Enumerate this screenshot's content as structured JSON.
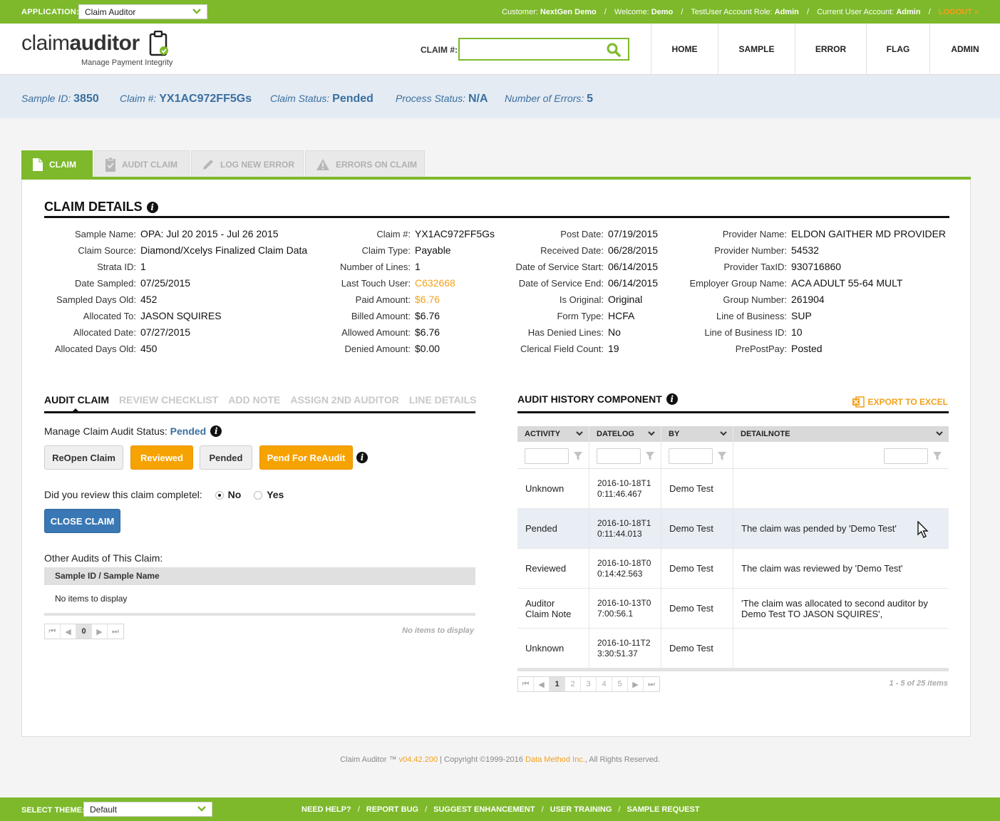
{
  "topbar": {
    "application_label": "APPLICATION:",
    "application_value": "Claim Auditor",
    "customer_label": "Customer:",
    "customer_value": "NextGen Demo",
    "welcome_label": "Welcome:",
    "welcome_value": "Demo",
    "role_label": "TestUser Account Role:",
    "role_value": "Admin",
    "current_label": "Current User Account:",
    "current_value": "Admin",
    "logout": "LOGOUT »",
    "separator": "/"
  },
  "header": {
    "logo_light": "claim",
    "logo_bold": "auditor",
    "logo_tagline": "Manage Payment Integrity",
    "claim_search_label": "CLAIM #:",
    "claim_search_value": "",
    "claim_search_placeholder": "",
    "nav": [
      {
        "label": "HOME"
      },
      {
        "label": "SAMPLE"
      },
      {
        "label": "ERROR"
      },
      {
        "label": "FLAG"
      },
      {
        "label": "ADMIN"
      }
    ]
  },
  "infobar": {
    "sample_id_label": "Sample ID:",
    "sample_id_value": "3850",
    "claim_label": "Claim #:",
    "claim_value": "YX1AC972FF5Gs",
    "claim_status_label": "Claim Status:",
    "claim_status_value": "Pended",
    "process_status_label": "Process Status:",
    "process_status_value": "N/A",
    "errors_label": "Number of Errors:",
    "errors_value": "5"
  },
  "tabs": [
    {
      "label": "CLAIM",
      "icon": "document-icon",
      "active": true
    },
    {
      "label": "AUDIT CLAIM",
      "icon": "checked-clipboard-icon",
      "active": false
    },
    {
      "label": "LOG NEW ERROR",
      "icon": "pencil-icon",
      "active": false
    },
    {
      "label": "ERRORS ON CLAIM",
      "icon": "warning-icon",
      "active": false
    }
  ],
  "claim_details": {
    "title": "CLAIM DETAILS",
    "col1": [
      {
        "label": "Sample Name:",
        "value": "OPA: Jul 20 2015 - Jul 26 2015"
      },
      {
        "label": "Claim Source:",
        "value": "Diamond/Xcelys Finalized Claim Data"
      },
      {
        "label": "Strata ID:",
        "value": "1"
      },
      {
        "label": "Date Sampled:",
        "value": "07/25/2015"
      },
      {
        "label": "Sampled Days Old:",
        "value": "452"
      },
      {
        "label": "Allocated To:",
        "value": "JASON SQUIRES"
      },
      {
        "label": "Allocated Date:",
        "value": "07/27/2015"
      },
      {
        "label": "Allocated Days Old:",
        "value": "450"
      }
    ],
    "col2": [
      {
        "label": "Claim #:",
        "value": "YX1AC972FF5Gs"
      },
      {
        "label": "Claim Type:",
        "value": "Payable"
      },
      {
        "label": "Number of Lines:",
        "value": "1"
      },
      {
        "label": "Last Touch User:",
        "value": "C632668"
      },
      {
        "label": "Paid Amount:",
        "value": "$6.76"
      },
      {
        "label": "Billed Amount:",
        "value": "$6.76"
      },
      {
        "label": "Allowed Amount:",
        "value": "$6.76"
      },
      {
        "label": "Denied Amount:",
        "value": "$0.00"
      }
    ],
    "col3": [
      {
        "label": "Post Date:",
        "value": "07/19/2015"
      },
      {
        "label": "Received Date:",
        "value": "06/28/2015"
      },
      {
        "label": "Date of Service Start:",
        "value": "06/14/2015"
      },
      {
        "label": "Date of Service End:",
        "value": "06/14/2015"
      },
      {
        "label": "Is Original:",
        "value": "Original"
      },
      {
        "label": "Form Type:",
        "value": "HCFA"
      },
      {
        "label": "Has Denied Lines:",
        "value": "No"
      },
      {
        "label": "Clerical Field Count:",
        "value": "19"
      }
    ],
    "col4": [
      {
        "label": "Provider Name:",
        "value": "ELDON GAITHER MD PROVIDER"
      },
      {
        "label": "Provider Number:",
        "value": "54532"
      },
      {
        "label": "Provider TaxID:",
        "value": "930716860"
      },
      {
        "label": "Employer Group Name:",
        "value": "ACA ADULT 55-64 MULT"
      },
      {
        "label": "Group Number:",
        "value": "261904"
      },
      {
        "label": "Line of Business:",
        "value": "SUP"
      },
      {
        "label": "Line of Business ID:",
        "value": "10"
      },
      {
        "label": "PrePostPay:",
        "value": "Posted"
      }
    ]
  },
  "audit_claim": {
    "subtabs": [
      {
        "label": "AUDIT CLAIM",
        "active": true
      },
      {
        "label": "REVIEW CHECKLIST",
        "active": false
      },
      {
        "label": "ADD NOTE",
        "active": false
      },
      {
        "label": "ASSIGN 2ND AUDITOR",
        "active": false
      },
      {
        "label": "LINE DETAILS",
        "active": false
      }
    ],
    "status_label": "Manage Claim Audit Status:",
    "status_value": "Pended",
    "buttons": {
      "reopen": "ReOpen Claim",
      "reviewed": "Reviewed",
      "pended": "Pended",
      "pend_reaudit": "Pend For ReAudit"
    },
    "review_question": "Did you review this claim completel:",
    "review_no": "No",
    "review_yes": "Yes",
    "review_selected": "No",
    "close_claim": "CLOSE CLAIM",
    "other_audits_label": "Other Audits of This Claim:",
    "other_audits_header": "Sample ID / Sample Name",
    "other_audits_empty": "No items to display",
    "pager_current": "0",
    "pager_note": "No items to display"
  },
  "audit_history": {
    "title": "AUDIT HISTORY COMPONENT",
    "export_label": "EXPORT TO EXCEL",
    "columns": [
      "ACTIVITY",
      "DATELOG",
      "BY",
      "DETAILNOTE"
    ],
    "rows": [
      {
        "activity": "Unknown",
        "datelog": "2016-10-18T10:11:46.467",
        "by": "Demo Test",
        "note": ""
      },
      {
        "activity": "Pended",
        "datelog": "2016-10-18T10:11:44.013",
        "by": "Demo Test",
        "note": "The claim was pended by 'Demo Test'"
      },
      {
        "activity": "Reviewed",
        "datelog": "2016-10-18T00:14:42.563",
        "by": "Demo Test",
        "note": "The claim was reviewed by 'Demo Test'"
      },
      {
        "activity": "Auditor Claim Note",
        "datelog": "2016-10-13T07:00:56.1",
        "by": "Demo Test",
        "note": "'The claim was allocated to second auditor by Demo Test TO JASON SQUIRES',"
      },
      {
        "activity": "Unknown",
        "datelog": "2016-10-11T23:30:51.37",
        "by": "Demo Test",
        "note": ""
      }
    ],
    "highlighted_row": 1,
    "pages": [
      "1",
      "2",
      "3",
      "4",
      "5"
    ],
    "current_page": "1",
    "pager_note": "1 - 5 of 25 items"
  },
  "footer": {
    "product": "Claim Auditor ™",
    "version": "v04.42.200",
    "copyright_pre": "|  Copyright ©1999-2016",
    "company": "Data Method Inc.",
    "copyright_post": ", All Rights Reserved.",
    "theme_label": "SELECT THEME:",
    "theme_value": "Default",
    "links": [
      "NEED HELP?",
      "REPORT BUG",
      "SUGGEST ENHANCEMENT",
      "USER TRAINING",
      "SAMPLE REQUEST"
    ],
    "link_separator": "/"
  },
  "colors": {
    "brand_green": "#7db92b",
    "accent_orange": "#f6a200",
    "link_blue": "#3a6f9f",
    "button_blue": "#3a78b5"
  }
}
